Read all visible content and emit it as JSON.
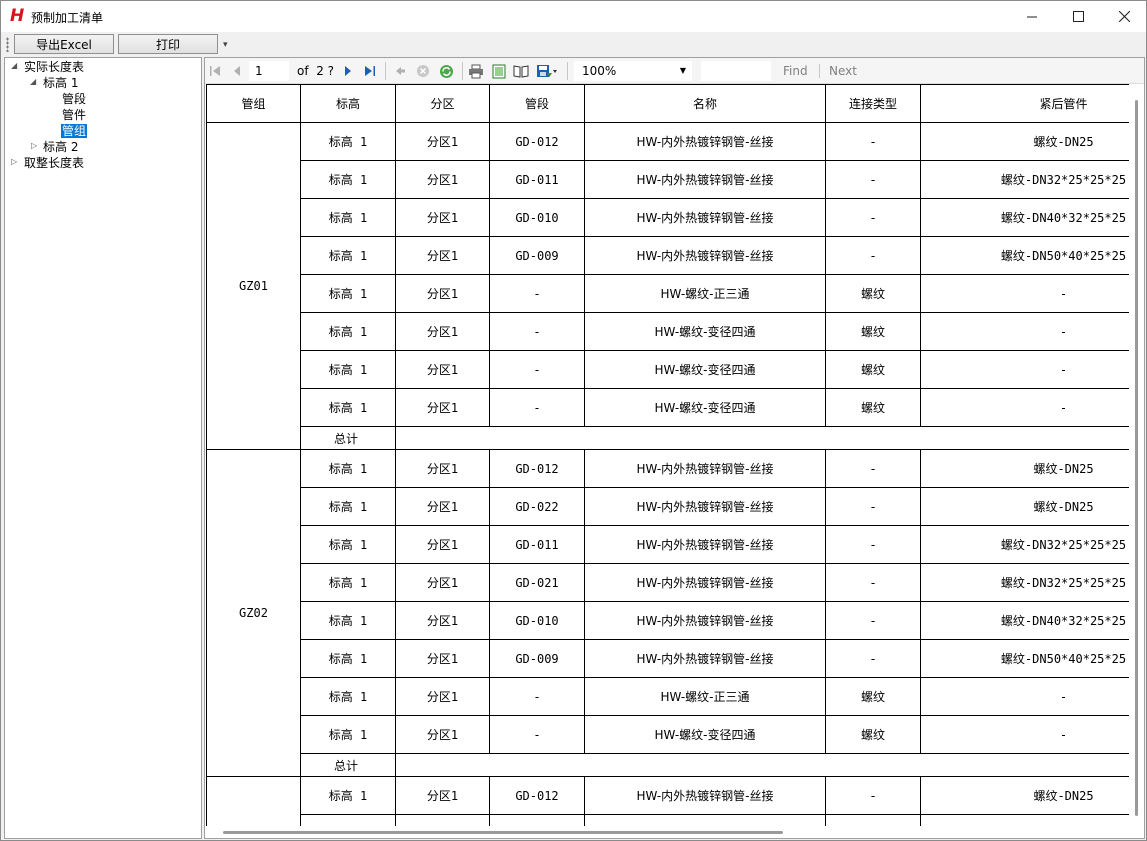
{
  "window": {
    "logo": "H",
    "title": "预制加工清单",
    "minimize_icon": "minimize-icon",
    "maximize_icon": "maximize-icon",
    "close_icon": "close-icon"
  },
  "toolbar": {
    "export_label": "导出Excel",
    "print_label": "打印",
    "overflow_glyph": "▾"
  },
  "tree": {
    "items": [
      {
        "label": "实际长度表",
        "expanded": true
      },
      {
        "label": "标高 1",
        "expanded": true
      },
      {
        "label": "管段"
      },
      {
        "label": "管件"
      },
      {
        "label": "管组",
        "selected": true
      },
      {
        "label": "标高 2",
        "expanded": false
      },
      {
        "label": "取整长度表",
        "expanded": false
      }
    ]
  },
  "report_toolbar": {
    "current_page": "1",
    "of_text": "of",
    "total_pages": "2 ?",
    "zoom": "100%",
    "find_label": "Find",
    "next_label": "Next"
  },
  "table": {
    "headers": [
      "管组",
      "标高",
      "分区",
      "管段",
      "名称",
      "连接类型",
      "紧后管件"
    ],
    "total_label": "总计",
    "groups": [
      {
        "name": "GZ01",
        "rows": [
          [
            "标高 1",
            "分区1",
            "GD-012",
            "HW-内外热镀锌钢管-丝接",
            "-",
            "螺纹-DN25"
          ],
          [
            "标高 1",
            "分区1",
            "GD-011",
            "HW-内外热镀锌钢管-丝接",
            "-",
            "螺纹-DN32*25*25*25"
          ],
          [
            "标高 1",
            "分区1",
            "GD-010",
            "HW-内外热镀锌钢管-丝接",
            "-",
            "螺纹-DN40*32*25*25"
          ],
          [
            "标高 1",
            "分区1",
            "GD-009",
            "HW-内外热镀锌钢管-丝接",
            "-",
            "螺纹-DN50*40*25*25"
          ],
          [
            "标高 1",
            "分区1",
            "-",
            "HW-螺纹-正三通",
            "螺纹",
            "-"
          ],
          [
            "标高 1",
            "分区1",
            "-",
            "HW-螺纹-变径四通",
            "螺纹",
            "-"
          ],
          [
            "标高 1",
            "分区1",
            "-",
            "HW-螺纹-变径四通",
            "螺纹",
            "-"
          ],
          [
            "标高 1",
            "分区1",
            "-",
            "HW-螺纹-变径四通",
            "螺纹",
            "-"
          ]
        ]
      },
      {
        "name": "GZ02",
        "rows": [
          [
            "标高 1",
            "分区1",
            "GD-012",
            "HW-内外热镀锌钢管-丝接",
            "-",
            "螺纹-DN25"
          ],
          [
            "标高 1",
            "分区1",
            "GD-022",
            "HW-内外热镀锌钢管-丝接",
            "-",
            "螺纹-DN25"
          ],
          [
            "标高 1",
            "分区1",
            "GD-011",
            "HW-内外热镀锌钢管-丝接",
            "-",
            "螺纹-DN32*25*25*25"
          ],
          [
            "标高 1",
            "分区1",
            "GD-021",
            "HW-内外热镀锌钢管-丝接",
            "-",
            "螺纹-DN32*25*25*25"
          ],
          [
            "标高 1",
            "分区1",
            "GD-010",
            "HW-内外热镀锌钢管-丝接",
            "-",
            "螺纹-DN40*32*25*25"
          ],
          [
            "标高 1",
            "分区1",
            "GD-009",
            "HW-内外热镀锌钢管-丝接",
            "-",
            "螺纹-DN50*40*25*25"
          ],
          [
            "标高 1",
            "分区1",
            "-",
            "HW-螺纹-正三通",
            "螺纹",
            "-"
          ],
          [
            "标高 1",
            "分区1",
            "-",
            "HW-螺纹-变径四通",
            "螺纹",
            "-"
          ]
        ]
      },
      {
        "name": "",
        "rows": [
          [
            "标高 1",
            "分区1",
            "GD-012",
            "HW-内外热镀锌钢管-丝接",
            "-",
            "螺纹-DN25"
          ],
          [
            "标高 1",
            "分区1",
            "",
            "",
            "",
            ""
          ]
        ]
      }
    ]
  },
  "colors": {
    "logo_red": "#d4161c",
    "selection_blue": "#0078d7",
    "disabled_text": "#808080"
  }
}
